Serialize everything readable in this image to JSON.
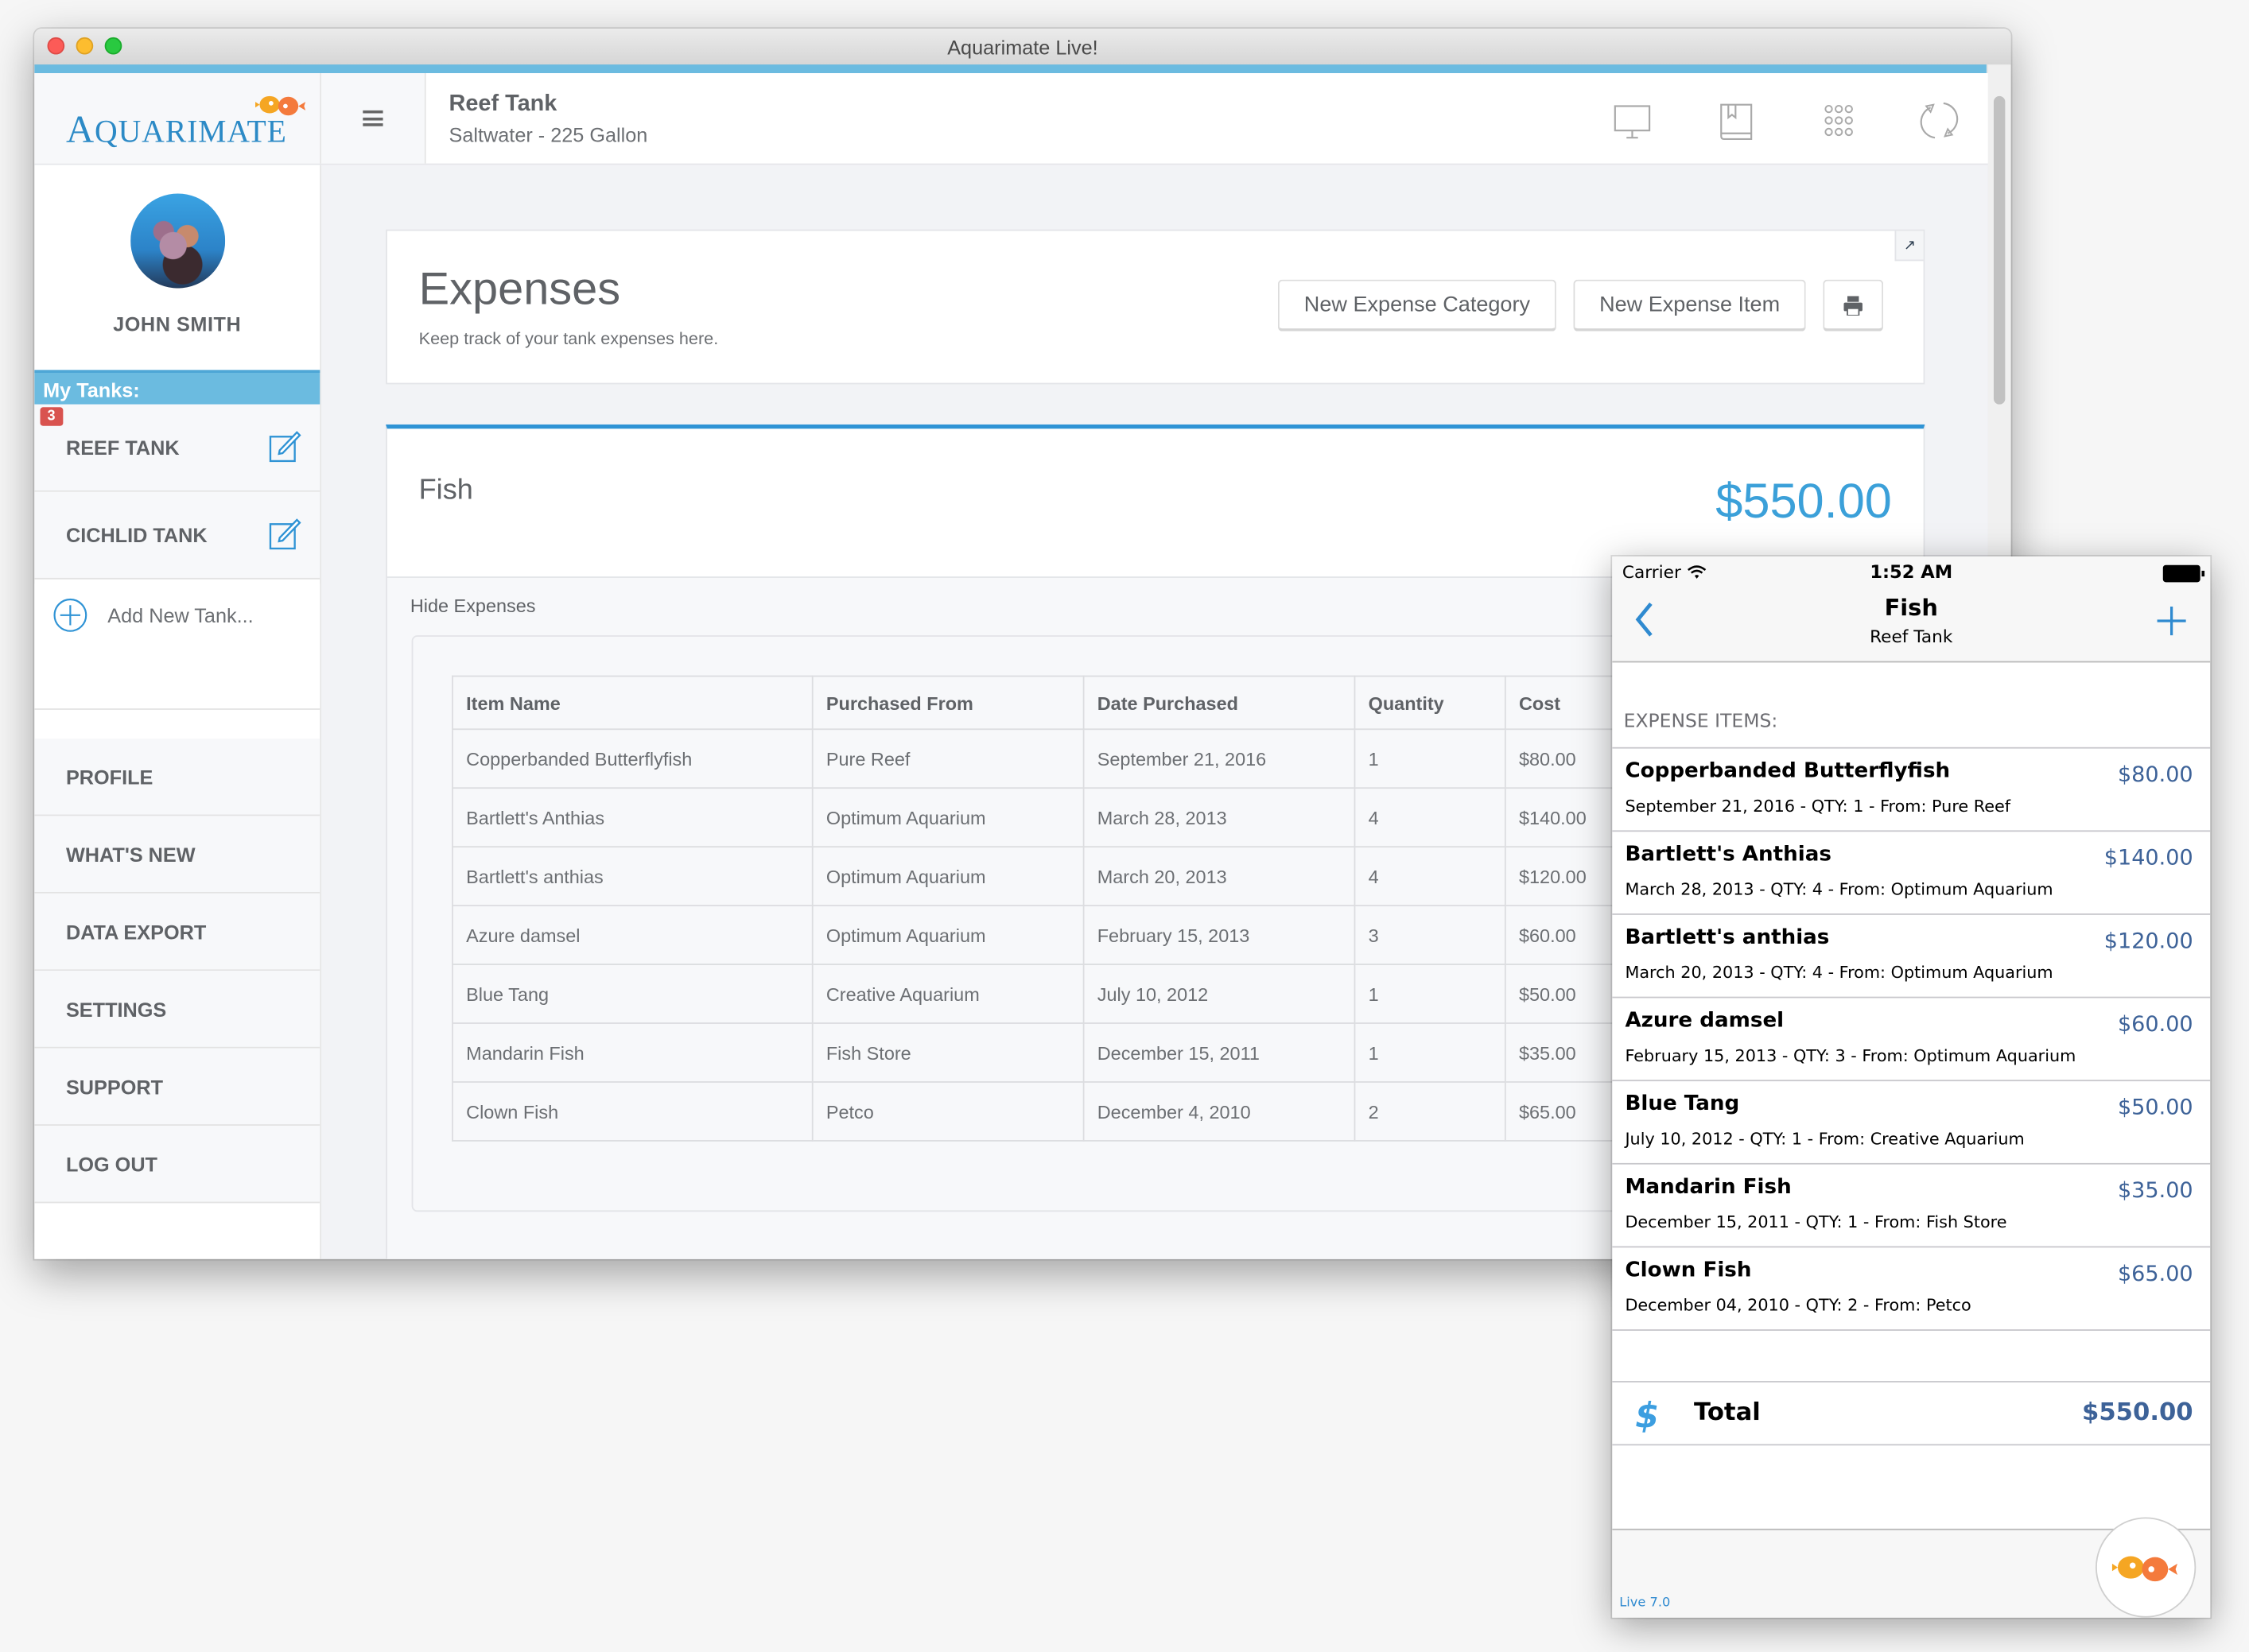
{
  "window": {
    "title": "Aquarimate Live!"
  },
  "brand": {
    "logo_first": "A",
    "logo_rest": "QUARIMATE",
    "accent": "#2f93d5",
    "header_bar": "#6bbbe0",
    "badge_red": "#d9534f"
  },
  "header": {
    "tank_name": "Reef Tank",
    "tank_desc": "Saltwater - 225 Gallon",
    "icons": [
      "monitor-icon",
      "book-icon",
      "grid-icon",
      "sync-icon"
    ]
  },
  "sidebar": {
    "user_name": "JOHN SMITH",
    "my_tanks_label": "My Tanks:",
    "tanks": [
      {
        "label": "REEF TANK",
        "badge": "3"
      },
      {
        "label": "CICHLID TANK"
      }
    ],
    "add_tank_label": "Add New Tank...",
    "nav": [
      "PROFILE",
      "WHAT'S NEW",
      "DATA EXPORT",
      "SETTINGS",
      "SUPPORT",
      "LOG OUT"
    ]
  },
  "expenses": {
    "title": "Expenses",
    "subtitle": "Keep track of your tank expenses here.",
    "new_category_label": "New Expense Category",
    "new_item_label": "New Expense Item",
    "print_icon": "print-icon",
    "expand_icon": "expand-icon"
  },
  "category": {
    "name": "Fish",
    "total": "$550.00",
    "hide_label": "Hide Expenses",
    "columns": [
      "Item Name",
      "Purchased From",
      "Date Purchased",
      "Quantity",
      "Cost"
    ],
    "rows": [
      [
        "Copperbanded Butterflyfish",
        "Pure Reef",
        "September 21, 2016",
        "1",
        "$80.00"
      ],
      [
        "Bartlett's Anthias",
        "Optimum Aquarium",
        "March 28, 2013",
        "4",
        "$140.00"
      ],
      [
        "Bartlett's anthias",
        "Optimum Aquarium",
        "March 20, 2013",
        "4",
        "$120.00"
      ],
      [
        "Azure damsel",
        "Optimum Aquarium",
        "February 15, 2013",
        "3",
        "$60.00"
      ],
      [
        "Blue Tang",
        "Creative Aquarium",
        "July 10, 2012",
        "1",
        "$50.00"
      ],
      [
        "Mandarin Fish",
        "Fish Store",
        "December 15, 2011",
        "1",
        "$35.00"
      ],
      [
        "Clown Fish",
        "Petco",
        "December 4, 2010",
        "2",
        "$65.00"
      ]
    ]
  },
  "phone": {
    "carrier": "Carrier",
    "time": "1:52 AM",
    "nav_title": "Fish",
    "nav_subtitle": "Reef Tank",
    "section_label": "EXPENSE ITEMS:",
    "items": [
      {
        "name": "Copperbanded Butterflyfish",
        "amount": "$80.00",
        "detail": "September 21, 2016 - QTY: 1 - From: Pure Reef"
      },
      {
        "name": "Bartlett's Anthias",
        "amount": "$140.00",
        "detail": "March 28, 2013 - QTY: 4 - From: Optimum Aquarium"
      },
      {
        "name": "Bartlett's anthias",
        "amount": "$120.00",
        "detail": "March 20, 2013 - QTY: 4 - From: Optimum Aquarium"
      },
      {
        "name": "Azure damsel",
        "amount": "$60.00",
        "detail": "February 15, 2013 - QTY: 3 - From: Optimum Aquarium"
      },
      {
        "name": "Blue Tang",
        "amount": "$50.00",
        "detail": "July 10, 2012 - QTY: 1 - From: Creative Aquarium"
      },
      {
        "name": "Mandarin Fish",
        "amount": "$35.00",
        "detail": "December 15, 2011 - QTY: 1 - From: Fish Store"
      },
      {
        "name": "Clown Fish",
        "amount": "$65.00",
        "detail": "December 04, 2010 - QTY: 2 - From: Petco"
      }
    ],
    "total_label": "Total",
    "total_amount": "$550.00",
    "dollar_glyph": "$",
    "version": "Live 7.0"
  }
}
